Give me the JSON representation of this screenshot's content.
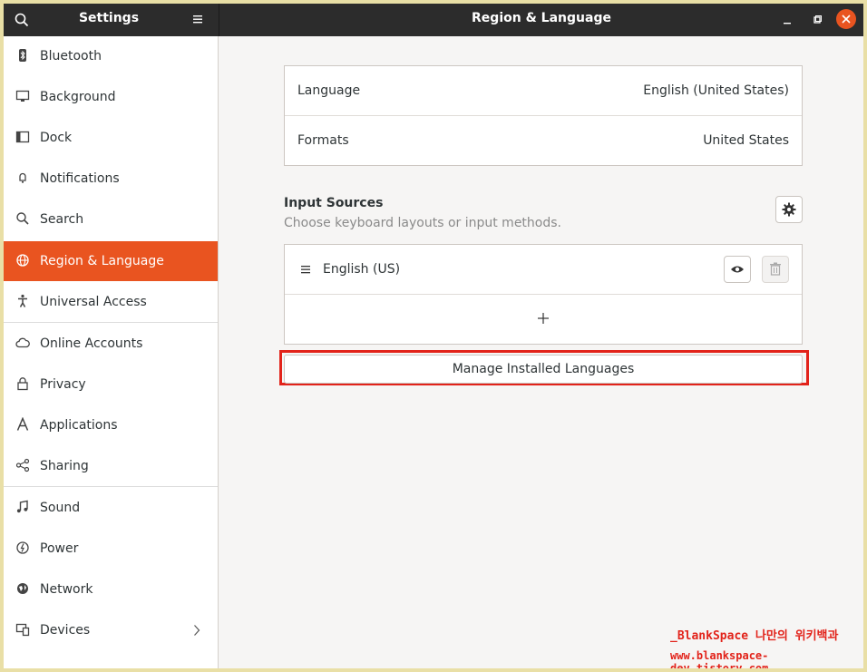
{
  "header": {
    "settings_title": "Settings",
    "page_title": "Region & Language"
  },
  "sidebar": {
    "items": [
      {
        "label": "Bluetooth",
        "icon": "bluetooth-icon"
      },
      {
        "label": "Background",
        "icon": "display-icon"
      },
      {
        "label": "Dock",
        "icon": "dock-icon"
      },
      {
        "label": "Notifications",
        "icon": "bell-icon"
      },
      {
        "label": "Search",
        "icon": "search-icon"
      },
      {
        "label": "Region & Language",
        "icon": "globe-icon",
        "active": true
      },
      {
        "label": "Universal Access",
        "icon": "accessibility-icon"
      },
      {
        "label": "Online Accounts",
        "icon": "cloud-icon"
      },
      {
        "label": "Privacy",
        "icon": "lock-icon"
      },
      {
        "label": "Applications",
        "icon": "applications-icon"
      },
      {
        "label": "Sharing",
        "icon": "share-icon"
      },
      {
        "label": "Sound",
        "icon": "music-note-icon"
      },
      {
        "label": "Power",
        "icon": "power-icon"
      },
      {
        "label": "Network",
        "icon": "network-icon"
      },
      {
        "label": "Devices",
        "icon": "devices-icon"
      }
    ]
  },
  "language_section": {
    "language_label": "Language",
    "language_value": "English (United States)",
    "formats_label": "Formats",
    "formats_value": "United States"
  },
  "input_sources": {
    "title": "Input Sources",
    "subtitle": "Choose keyboard layouts or input methods.",
    "items": [
      {
        "label": "English (US)"
      }
    ]
  },
  "manage_button": "Manage Installed Languages",
  "watermark": {
    "line1": "_BlankSpace 나만의 위키백과",
    "line2": "www.blankspace-dev.tistory.com"
  },
  "colors": {
    "accent": "#e95420",
    "headerbar": "#2c2c2c",
    "highlight": "#e2231a"
  }
}
